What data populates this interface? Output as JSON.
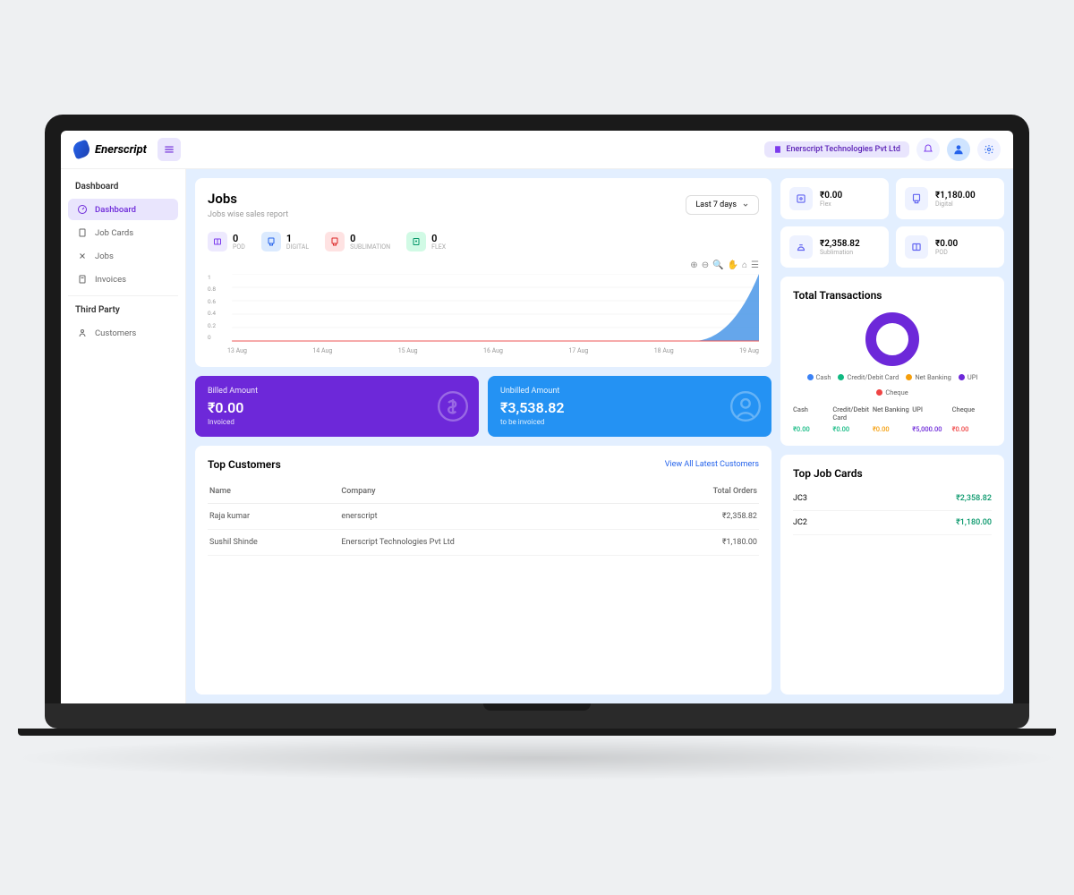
{
  "topbar": {
    "brand": "Enerscript",
    "org_label": "Enerscript Technologies Pvt Ltd"
  },
  "sidebar": {
    "section1": "Dashboard",
    "items": [
      {
        "label": "Dashboard"
      },
      {
        "label": "Job Cards"
      },
      {
        "label": "Jobs"
      },
      {
        "label": "Invoices"
      }
    ],
    "section2": "Third Party",
    "items2": [
      {
        "label": "Customers"
      }
    ]
  },
  "jobs": {
    "title": "Jobs",
    "subtitle": "Jobs wise sales report",
    "range": "Last 7 days",
    "stats": [
      {
        "value": "0",
        "label": "POD",
        "color": "purple"
      },
      {
        "value": "1",
        "label": "DIGITAL",
        "color": "blue"
      },
      {
        "value": "0",
        "label": "Sublimation",
        "color": "red"
      },
      {
        "value": "0",
        "label": "Flex",
        "color": "green"
      }
    ]
  },
  "chart_data": {
    "type": "area",
    "x": [
      "13 Aug",
      "14 Aug",
      "15 Aug",
      "16 Aug",
      "17 Aug",
      "18 Aug",
      "19 Aug"
    ],
    "y": [
      0,
      0,
      0,
      0,
      0,
      0,
      1
    ],
    "ylim": [
      0,
      1
    ],
    "yticks": [
      0,
      0.2,
      0.4,
      0.6,
      0.8,
      1
    ],
    "title": "",
    "xlabel": "",
    "ylabel": ""
  },
  "amounts": {
    "billed": {
      "label": "Billed Amount",
      "value": "₹0.00",
      "sub": "Invoiced"
    },
    "unbilled": {
      "label": "Unbilled Amount",
      "value": "₹3,538.82",
      "sub": "to be invoiced"
    }
  },
  "top_customers": {
    "title": "Top Customers",
    "link": "View All Latest Customers",
    "cols": [
      "Name",
      "Company",
      "Total Orders"
    ],
    "rows": [
      {
        "name": "Raja kumar",
        "company": "enerscript",
        "total": "₹2,358.82"
      },
      {
        "name": "Sushil Shinde",
        "company": "Enerscript Technologies Pvt Ltd",
        "total": "₹1,180.00"
      }
    ]
  },
  "metrics": [
    {
      "value": "₹0.00",
      "label": "Flex"
    },
    {
      "value": "₹1,180.00",
      "label": "Digital"
    },
    {
      "value": "₹2,358.82",
      "label": "Sublimation"
    },
    {
      "value": "₹0.00",
      "label": "POD"
    }
  ],
  "transactions": {
    "title": "Total Transactions",
    "legend": [
      {
        "label": "Cash",
        "color": "#3b82f6"
      },
      {
        "label": "Credit/Debit Card",
        "color": "#10b981"
      },
      {
        "label": "Net Banking",
        "color": "#f59e0b"
      },
      {
        "label": "UPI",
        "color": "#6d28d9"
      },
      {
        "label": "Cheque",
        "color": "#ef4444"
      }
    ],
    "table": {
      "cols": [
        "Cash",
        "Credit/Debit Card",
        "Net Banking",
        "UPI",
        "Cheque"
      ],
      "vals": [
        "₹0.00",
        "₹0.00",
        "₹0.00",
        "₹5,000.00",
        "₹0.00"
      ]
    }
  },
  "top_jobcards": {
    "title": "Top Job Cards",
    "rows": [
      {
        "id": "JC3",
        "amount": "₹2,358.82"
      },
      {
        "id": "JC2",
        "amount": "₹1,180.00"
      }
    ]
  }
}
